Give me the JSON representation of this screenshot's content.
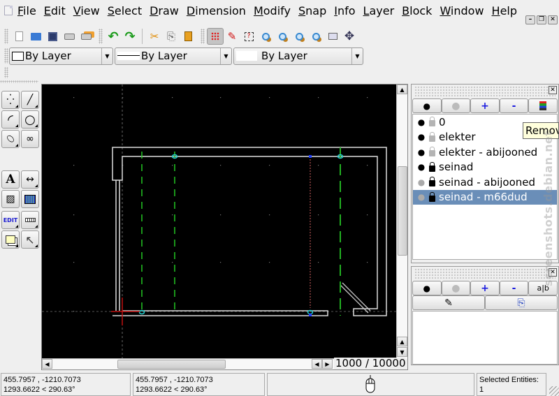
{
  "menubar": {
    "items": [
      {
        "label": "File",
        "mnemonic": "F",
        "rest": "ile"
      },
      {
        "label": "Edit",
        "mnemonic": "E",
        "rest": "dit"
      },
      {
        "label": "View",
        "mnemonic": "V",
        "rest": "iew"
      },
      {
        "label": "Select",
        "mnemonic": "S",
        "rest": "elect"
      },
      {
        "label": "Draw",
        "mnemonic": "D",
        "rest": "raw"
      },
      {
        "label": "Dimension",
        "mnemonic": "D",
        "rest": "imension"
      },
      {
        "label": "Modify",
        "mnemonic": "M",
        "rest": "odify"
      },
      {
        "label": "Snap",
        "mnemonic": "S",
        "rest": "nap"
      },
      {
        "label": "Info",
        "mnemonic": "I",
        "rest": "nfo"
      },
      {
        "label": "Layer",
        "mnemonic": "L",
        "rest": "ayer"
      },
      {
        "label": "Block",
        "mnemonic": "B",
        "rest": "lock"
      },
      {
        "label": "Window",
        "mnemonic": "W",
        "rest": "indow"
      },
      {
        "label": "Help",
        "mnemonic": "H",
        "rest": "elp"
      }
    ],
    "window_controls": {
      "minimize": "–",
      "restore": "❐",
      "close": "✕"
    }
  },
  "toolbar": {
    "file_tools": [
      {
        "name": "new-file",
        "glyph": "🗋"
      },
      {
        "name": "open-file",
        "glyph": "📂"
      },
      {
        "name": "save",
        "glyph": "💾"
      },
      {
        "name": "print",
        "glyph": "🖶"
      },
      {
        "name": "print-preview",
        "glyph": "🖶"
      }
    ],
    "history_tools": [
      {
        "name": "undo",
        "glyph": "↶"
      },
      {
        "name": "redo",
        "glyph": "↷"
      }
    ],
    "edit_tools": [
      {
        "name": "cut",
        "glyph": "✂"
      },
      {
        "name": "copy",
        "glyph": "⎘"
      },
      {
        "name": "paste",
        "glyph": "📋"
      }
    ],
    "view_tools": [
      {
        "name": "grid",
        "glyph": "⁙",
        "active": true
      },
      {
        "name": "draft",
        "glyph": "✎"
      },
      {
        "name": "redraw",
        "glyph": "⟲"
      },
      {
        "name": "zoom-in",
        "glyph": "🔍"
      },
      {
        "name": "zoom-out",
        "glyph": "🔍"
      },
      {
        "name": "zoom-auto",
        "glyph": "🔍"
      },
      {
        "name": "zoom-previous",
        "glyph": "🔍"
      },
      {
        "name": "zoom-window",
        "glyph": "⬚"
      },
      {
        "name": "zoom-pan",
        "glyph": "✥"
      }
    ]
  },
  "pen_toolbar": {
    "color": {
      "value": "By Layer"
    },
    "width": {
      "value": "By Layer"
    },
    "linetype": {
      "value": "By Layer"
    }
  },
  "palette": {
    "tools": [
      {
        "name": "points",
        "glyph": "⁛"
      },
      {
        "name": "lines",
        "glyph": "╱"
      },
      {
        "name": "arcs",
        "glyph": "◜"
      },
      {
        "name": "circles",
        "glyph": "○"
      },
      {
        "name": "ellipses",
        "glyph": "⬯"
      },
      {
        "name": "splines",
        "glyph": "∞"
      },
      {
        "name": "text",
        "glyph": "A"
      },
      {
        "name": "dimensions",
        "glyph": "↔"
      },
      {
        "name": "hatch",
        "glyph": "▨"
      },
      {
        "name": "image",
        "glyph": "▦"
      },
      {
        "name": "edit",
        "glyph": "EDIT"
      },
      {
        "name": "measure",
        "glyph": "📏"
      },
      {
        "name": "block",
        "glyph": "⧉"
      },
      {
        "name": "select",
        "glyph": "↖"
      }
    ]
  },
  "canvas": {
    "background": "#000000",
    "grid_readout": "1000 / 10000"
  },
  "layer_dock": {
    "buttons": [
      {
        "name": "show-all",
        "glyph": "👁"
      },
      {
        "name": "hide-all",
        "glyph": "●"
      },
      {
        "name": "add-layer",
        "glyph": "+"
      },
      {
        "name": "remove-layer",
        "glyph": "-"
      },
      {
        "name": "edit-layer",
        "glyph": "☰"
      }
    ],
    "layers": [
      {
        "name": "0",
        "visible": true,
        "locked": false,
        "selected": false
      },
      {
        "name": "elekter",
        "visible": true,
        "locked": false,
        "selected": false
      },
      {
        "name": "elekter - abijooned",
        "visible": true,
        "locked": false,
        "selected": false
      },
      {
        "name": "seinad",
        "visible": true,
        "locked": true,
        "selected": false
      },
      {
        "name": "seinad - abijooned",
        "visible": false,
        "locked": true,
        "selected": false
      },
      {
        "name": "seinad - m66dud",
        "visible": false,
        "locked": true,
        "selected": true
      }
    ],
    "tooltip": "Remove"
  },
  "block_dock": {
    "buttons": [
      {
        "name": "show-all",
        "glyph": "👁"
      },
      {
        "name": "hide-all",
        "glyph": "●"
      },
      {
        "name": "add-block",
        "glyph": "+"
      },
      {
        "name": "remove-block",
        "glyph": "-"
      },
      {
        "name": "rename-block",
        "glyph": "a|b"
      }
    ],
    "buttons_row2": [
      {
        "name": "edit-block",
        "glyph": "✎"
      },
      {
        "name": "insert-block",
        "glyph": "⎘"
      }
    ]
  },
  "watermark": "screenshots.debian.net",
  "statusbar": {
    "abs_coords": "455.7957 , -1210.7073",
    "abs_polar": "1293.6622 < 290.63°",
    "rel_coords": "455.7957 , -1210.7073",
    "rel_polar": "1293.6622 < 290.63°",
    "selected_label": "Selected Entities:",
    "selected_count": "1"
  }
}
